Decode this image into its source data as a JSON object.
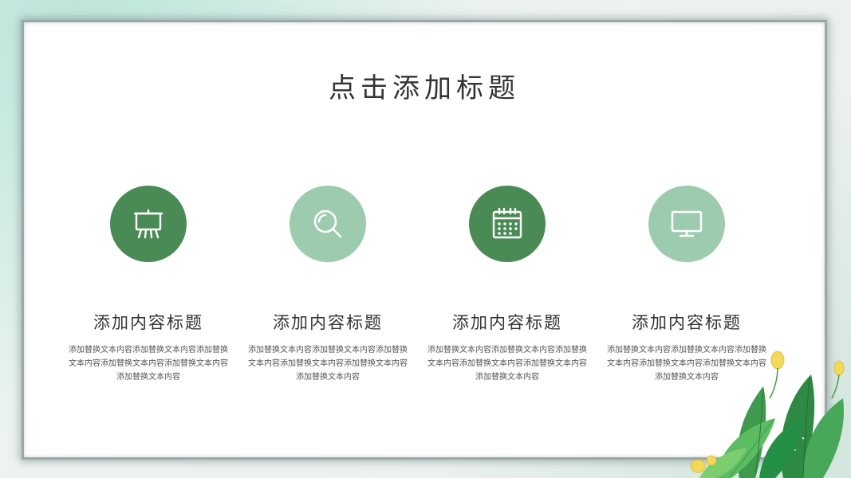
{
  "slide": {
    "title": "点击添加标题",
    "features": [
      {
        "icon": "easel-board-icon",
        "circle_color": "#4a8a55",
        "title": "添加内容标题",
        "text": "添加替换文本内容添加替换文本内容添加替换文本内容添加替换文本内容添加替换文本内容添加替换文本内容"
      },
      {
        "icon": "magnifier-icon",
        "circle_color": "#9ccbad",
        "title": "添加内容标题",
        "text": "添加替换文本内容添加替换文本内容添加替换文本内容添加替换文本内容添加替换文本内容添加替换文本内容"
      },
      {
        "icon": "calendar-icon",
        "circle_color": "#4a8a55",
        "title": "添加内容标题",
        "text": "添加替换文本内容添加替换文本内容添加替换文本内容添加替换文本内容添加替换文本内容添加替换文本内容"
      },
      {
        "icon": "monitor-icon",
        "circle_color": "#9ccbad",
        "title": "添加内容标题",
        "text": "添加替换文本内容添加替换文本内容添加替换文本内容添加替换文本内容添加替换文本内容添加替换文本内容"
      }
    ]
  },
  "colors": {
    "dark_green": "#4a8a55",
    "light_green": "#9ccbad",
    "frame_gray": "#9aa8ab",
    "text_dark": "#333333"
  }
}
